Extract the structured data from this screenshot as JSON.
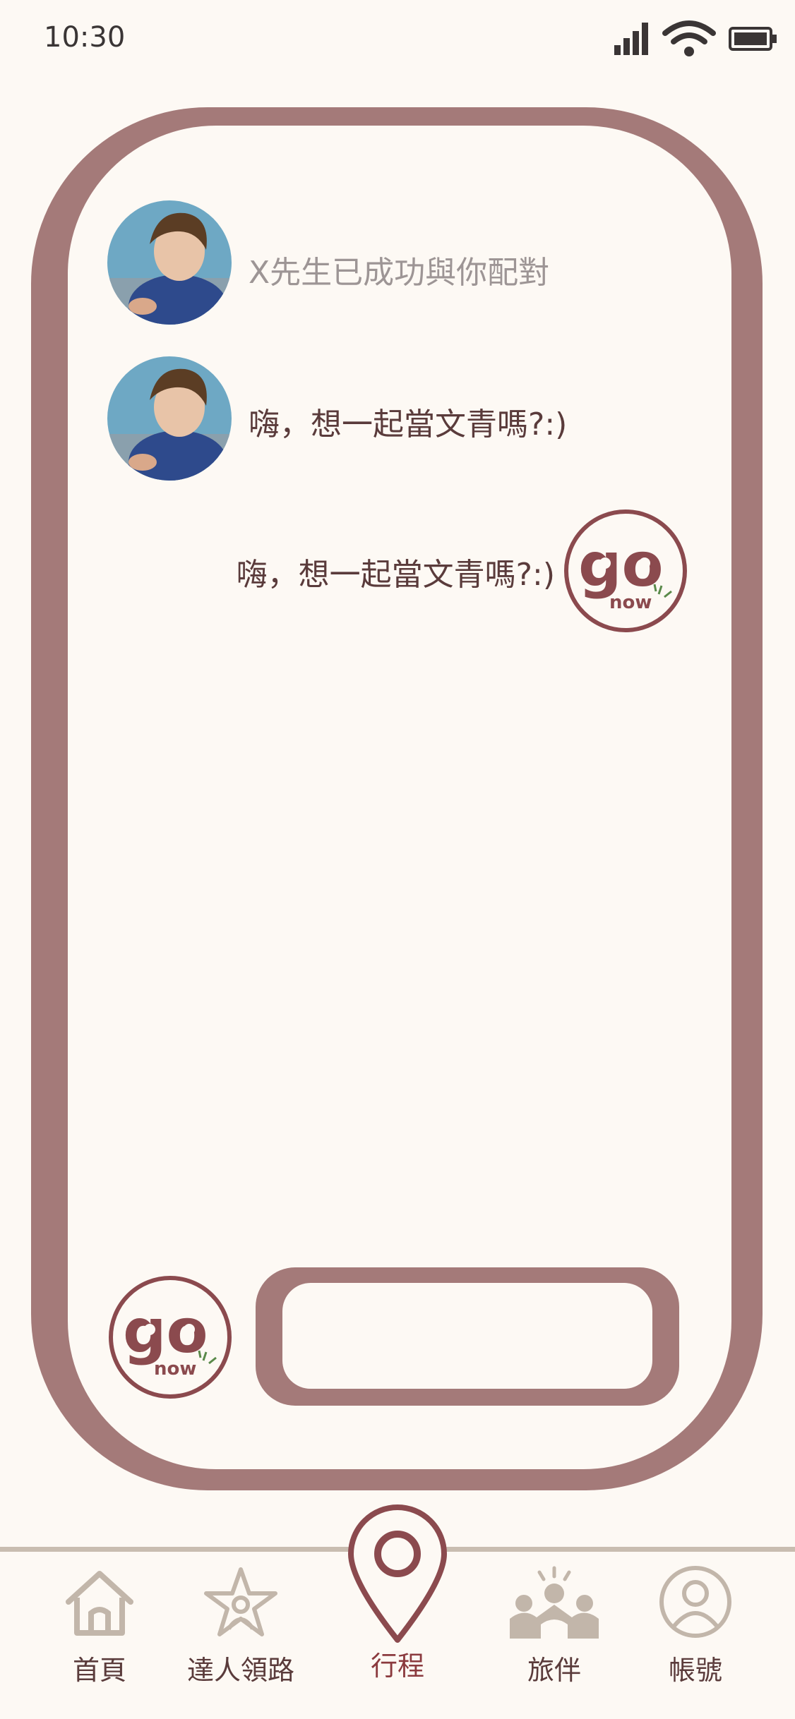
{
  "status_bar": {
    "time": "10:30"
  },
  "chat": {
    "system_message": "X先生已成功與你配對",
    "incoming_message": "嗨，想一起當文青嗎?:)",
    "outgoing_message": "嗨，想一起當文青嗎?:)",
    "input": {
      "value": "",
      "placeholder": ""
    }
  },
  "logo": {
    "text_big": "go",
    "text_small": "now"
  },
  "tabbar": {
    "items": [
      {
        "label": "首頁",
        "icon": "home-icon"
      },
      {
        "label": "達人領路",
        "icon": "star-guide-icon"
      },
      {
        "label": "行程",
        "icon": "location-pin-icon",
        "active": true
      },
      {
        "label": "旅伴",
        "icon": "companions-icon"
      },
      {
        "label": "帳號",
        "icon": "account-icon"
      }
    ]
  },
  "colors": {
    "background": "#fdf9f4",
    "frame": "#a47a79",
    "accent": "#8b3a3e",
    "inactive_icon": "#c2b6aa",
    "text_dark": "#5a3b3b",
    "text_gray": "#9d9595"
  }
}
